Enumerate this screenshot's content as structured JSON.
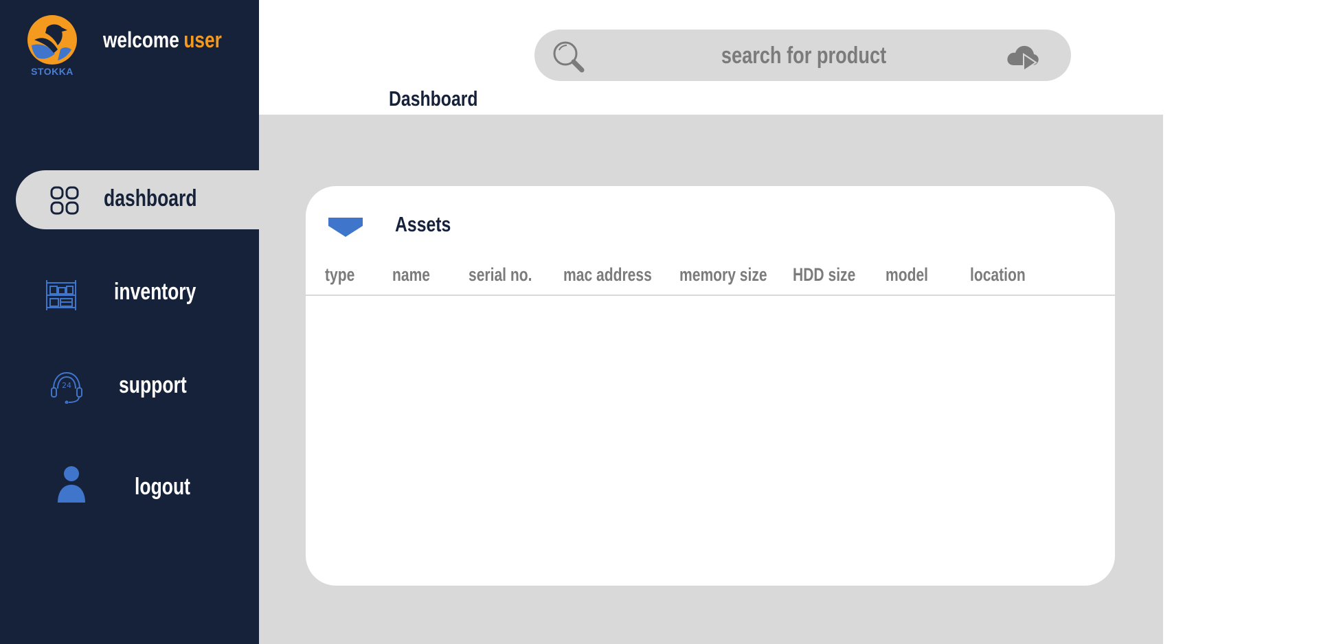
{
  "app": {
    "logo_text": "STOKKA",
    "welcome_text": "welcome",
    "welcome_user": "user"
  },
  "sidebar": {
    "items": [
      {
        "label": "dashboard",
        "icon": "grid-icon",
        "active": true
      },
      {
        "label": "inventory",
        "icon": "shelves-icon",
        "active": false
      },
      {
        "label": "support",
        "icon": "headset-24-icon",
        "active": false
      },
      {
        "label": "logout",
        "icon": "user-icon",
        "active": false
      }
    ],
    "collapse_arrow": ">"
  },
  "search": {
    "placeholder": "search for product",
    "value": ""
  },
  "page_title": "Dashboard",
  "assets": {
    "title": "Assets",
    "columns": [
      "type",
      "name",
      "serial no.",
      "mac address",
      "memory size",
      "HDD size",
      "model",
      "location"
    ],
    "rows": []
  },
  "colors": {
    "sidebar_bg": "#16213a",
    "accent_orange": "#f39a1f",
    "accent_blue": "#3f76cc",
    "panel_grey": "#d9d9d9",
    "muted_text": "#7b7b7b"
  }
}
